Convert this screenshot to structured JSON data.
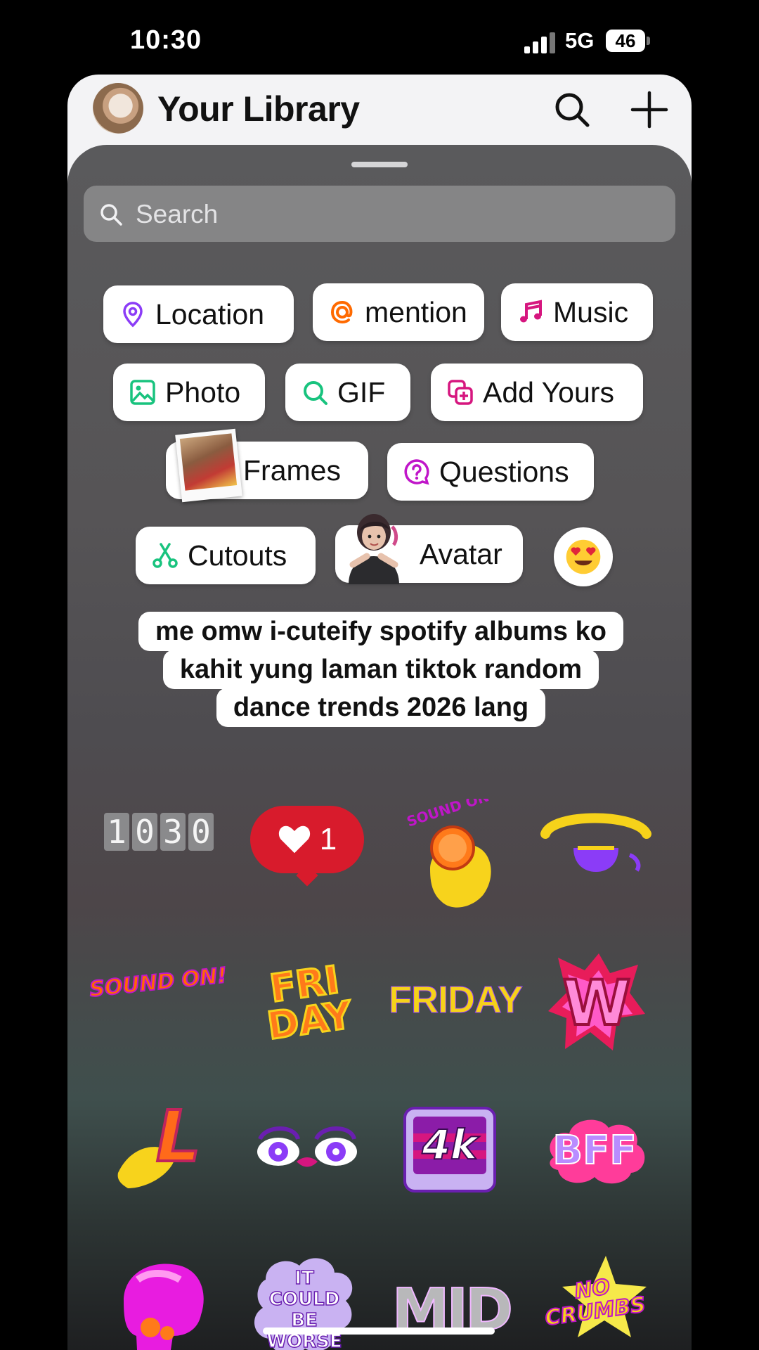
{
  "status_bar": {
    "time": "10:30",
    "network": "5G",
    "battery": "46"
  },
  "library": {
    "title": "Your Library"
  },
  "sheet": {
    "search_placeholder": "Search",
    "stickers": [
      {
        "label": "Location",
        "icon": "location-pin-icon"
      },
      {
        "label": "mention",
        "icon": "at-icon"
      },
      {
        "label": "Music",
        "icon": "music-note-icon"
      },
      {
        "label": "Photo",
        "icon": "photo-icon"
      },
      {
        "label": "GIF",
        "icon": "gif-search-icon"
      },
      {
        "label": "Add Yours",
        "icon": "add-yours-icon"
      },
      {
        "label": "Frames",
        "icon": "frames-photo-icon"
      },
      {
        "label": "Questions",
        "icon": "question-bubble-icon"
      },
      {
        "label": "Cutouts",
        "icon": "scissors-icon"
      },
      {
        "label": "Avatar",
        "icon": "avatar-icon"
      }
    ],
    "caption_lines": [
      "me omw i-cuteify spotify albums ko",
      "kahit yung laman tiktok random",
      "dance trends 2026 lang"
    ],
    "grid": {
      "clock_digits": [
        "1",
        "0",
        "3",
        "0"
      ],
      "like_count": "1",
      "friday_text": "FRIDAY",
      "sound_on_text": "SOUND ON!",
      "fri_day_text": "FRI DAY",
      "w_text": "W",
      "l_text": "L",
      "4k_text": "4k",
      "bff_text": "BFF",
      "could_be_worse_text": "IT COULD BE WORSE",
      "mid_text": "MID",
      "no_crumbs_text": "NO CRUMBS",
      "sound_text": "SOUND ON"
    }
  },
  "colors": {
    "like_red": "#d81b2c",
    "friday_yellow": "#f6d21a",
    "accent_purple": "#8b3cf7",
    "accent_orange": "#ff6a00",
    "accent_pink": "#d6167f",
    "accent_green": "#18c37e"
  }
}
